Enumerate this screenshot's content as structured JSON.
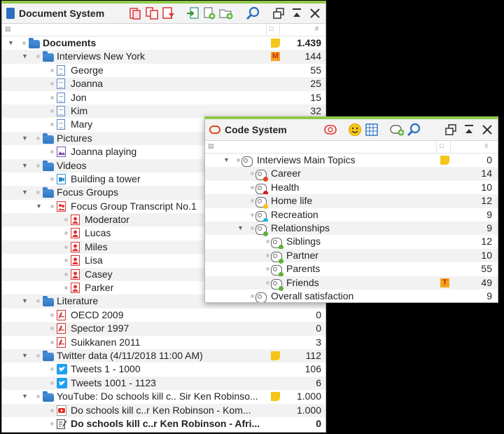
{
  "doc": {
    "title": "Document System",
    "colhdr": {
      "c1": "▤",
      "c2": "□",
      "c3": "#"
    },
    "rows": [
      {
        "label": "Documents",
        "num": "1.439",
        "bold": true,
        "icon": "folder",
        "tri": "▼",
        "memo": "yellow",
        "level": 0
      },
      {
        "label": "Interviews New York",
        "num": "144",
        "bold": false,
        "icon": "folder",
        "tri": "▼",
        "memo": "M",
        "level": 1
      },
      {
        "label": "George",
        "num": "55",
        "icon": "doc",
        "level": 2
      },
      {
        "label": "Joanna",
        "num": "25",
        "icon": "doc",
        "level": 2
      },
      {
        "label": "Jon",
        "num": "15",
        "icon": "doc",
        "level": 2
      },
      {
        "label": "Kim",
        "num": "32",
        "icon": "doc",
        "level": 2
      },
      {
        "label": "Mary",
        "num": "",
        "icon": "doc",
        "level": 2
      },
      {
        "label": "Pictures",
        "num": "",
        "icon": "folder",
        "tri": "▼",
        "level": 1
      },
      {
        "label": "Joanna playing",
        "num": "",
        "icon": "image",
        "level": 2
      },
      {
        "label": "Videos",
        "num": "",
        "icon": "folder",
        "tri": "▼",
        "level": 1
      },
      {
        "label": "Building a tower",
        "num": "",
        "icon": "video",
        "level": 2
      },
      {
        "label": "Focus Groups",
        "num": "",
        "icon": "folder",
        "tri": "▼",
        "level": 1
      },
      {
        "label": "Focus Group Transcript No.1",
        "num": "",
        "icon": "group",
        "tri": "▼",
        "level": 2
      },
      {
        "label": "Moderator",
        "num": "",
        "icon": "speaker",
        "level": 3
      },
      {
        "label": "Lucas",
        "num": "",
        "icon": "speaker",
        "level": 3
      },
      {
        "label": "Miles",
        "num": "",
        "icon": "speaker",
        "level": 3
      },
      {
        "label": "Lisa",
        "num": "",
        "icon": "speaker",
        "level": 3
      },
      {
        "label": "Casey",
        "num": "",
        "icon": "speaker",
        "level": 3
      },
      {
        "label": "Parker",
        "num": "",
        "icon": "speaker",
        "level": 3
      },
      {
        "label": "Literature",
        "num": "",
        "icon": "folder",
        "tri": "▼",
        "level": 1
      },
      {
        "label": "OECD 2009",
        "num": "0",
        "icon": "pdf",
        "level": 2
      },
      {
        "label": "Spector 1997",
        "num": "0",
        "icon": "pdf",
        "level": 2
      },
      {
        "label": "Suikkanen 2011",
        "num": "3",
        "icon": "pdf",
        "level": 2
      },
      {
        "label": "Twitter data (4/11/2018 11:00 AM)",
        "num": "112",
        "icon": "folder",
        "tri": "▼",
        "memo": "yellow",
        "level": 1
      },
      {
        "label": "Tweets 1 - 1000",
        "num": "106",
        "icon": "twitter",
        "level": 2
      },
      {
        "label": "Tweets 1001 - 1123",
        "num": "6",
        "icon": "twitter",
        "level": 2
      },
      {
        "label": "YouTube: Do schools kill c.. Sir Ken Robinso...",
        "num": "1.000",
        "icon": "folder",
        "tri": "▼",
        "memo": "yellow",
        "level": 1
      },
      {
        "label": "Do schools kill c..r Ken Robinson -  Kom...",
        "num": "1.000",
        "icon": "youtube",
        "level": 2
      },
      {
        "label": "Do schools kill c..r Ken Robinson - Afri...",
        "num": "0",
        "icon": "edit",
        "bold": true,
        "level": 2
      }
    ]
  },
  "code": {
    "title": "Code System",
    "colhdr": {
      "c1": "▤",
      "c2": "□",
      "c3": "◊"
    },
    "rows": [
      {
        "label": "Interviews Main Topics",
        "num": "0",
        "tri": "▼",
        "memo": "yellow",
        "level": 0,
        "color": ""
      },
      {
        "label": "Career",
        "num": "14",
        "level": 1,
        "color": "#e0471f"
      },
      {
        "label": "Health",
        "num": "10",
        "level": 1,
        "color": "#d81f1f"
      },
      {
        "label": "Home life",
        "num": "12",
        "level": 1,
        "color": "#f2c418"
      },
      {
        "label": "Recreation",
        "num": "9",
        "level": 1,
        "color": "#19b6d8"
      },
      {
        "label": "Relationships",
        "num": "9",
        "tri": "▼",
        "level": 1,
        "color": "#5bb336"
      },
      {
        "label": "Siblings",
        "num": "12",
        "level": 2,
        "color": "#5bb336"
      },
      {
        "label": "Partner",
        "num": "10",
        "level": 2,
        "color": "#5bb336"
      },
      {
        "label": "Parents",
        "num": "55",
        "level": 2,
        "color": "#5bb336"
      },
      {
        "label": "Friends",
        "num": "49",
        "memo": "T",
        "level": 2,
        "color": "#5bb336"
      },
      {
        "label": "Overall satisfaction",
        "num": "9",
        "level": 1,
        "color": ""
      }
    ]
  }
}
